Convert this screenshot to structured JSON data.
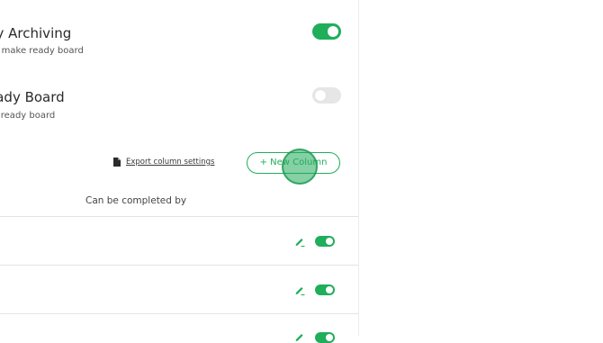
{
  "settings": [
    {
      "title": "dy Archiving",
      "description": "he make ready board",
      "enabled": true
    },
    {
      "title": "eady Board",
      "description": "ke ready board",
      "enabled": false
    }
  ],
  "toolbar": {
    "export_label": "Export column settings",
    "new_column_label": "+ New Column"
  },
  "table": {
    "column_header": "Can be completed by",
    "rows": [
      {
        "enabled": true
      },
      {
        "enabled": true
      },
      {
        "enabled": true
      }
    ]
  },
  "colors": {
    "accent": "#1fae5a",
    "toggle_off": "#e6e6e6"
  }
}
